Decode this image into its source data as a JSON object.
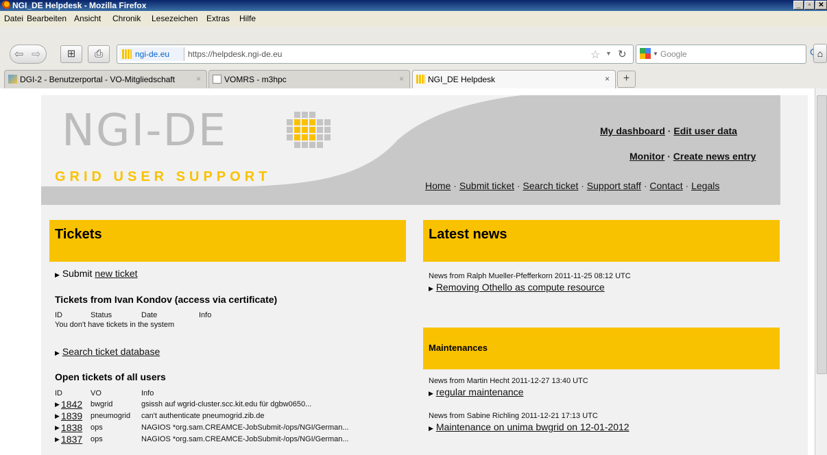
{
  "window": {
    "title": "NGI_DE Helpdesk - Mozilla Firefox"
  },
  "menu": [
    "Datei",
    "Bearbeiten",
    "Ansicht",
    "Chronik",
    "Lesezeichen",
    "Extras",
    "Hilfe"
  ],
  "urlbar": {
    "site": "ngi-de.eu",
    "url": "https://helpdesk.ngi-de.eu"
  },
  "search": {
    "placeholder": "Google"
  },
  "tabs": [
    {
      "label": "DGI-2 - Benutzerportal - VO-Mitgliedschaft"
    },
    {
      "label": "VOMRS - m3hpc"
    },
    {
      "label": "NGI_DE Helpdesk"
    }
  ],
  "logo": {
    "main": "NGI-DE",
    "sub": "GRID USER SUPPORT"
  },
  "header_links": {
    "dashboard": "My dashboard",
    "edit_user": "Edit user data",
    "monitor": "Monitor",
    "create_news": "Create news entry",
    "sep": "·"
  },
  "nav": [
    "Home",
    "Submit ticket",
    "Search ticket",
    "Support staff",
    "Contact",
    "Legals"
  ],
  "tickets": {
    "title": "Tickets",
    "submit_prefix": "Submit",
    "submit_link": "new ticket",
    "user_heading": "Tickets from Ivan Kondov (access via certificate)",
    "cols": {
      "id": "ID",
      "status": "Status",
      "date": "Date",
      "info": "Info",
      "vo": "VO"
    },
    "empty_msg": "You don't have tickets in the system",
    "search_link": "Search ticket database",
    "open_heading": "Open tickets of all users",
    "rows": [
      {
        "id": "1842",
        "vo": "bwgrid",
        "info": "gsissh auf wgrid-cluster.scc.kit.edu für dgbw0650..."
      },
      {
        "id": "1839",
        "vo": "pneumogrid",
        "info": "can't authenticate pneumogrid.zib.de"
      },
      {
        "id": "1838",
        "vo": "ops",
        "info": "NAGIOS *org.sam.CREAMCE-JobSubmit-/ops/NGI/German..."
      },
      {
        "id": "1837",
        "vo": "ops",
        "info": "NAGIOS *org.sam.CREAMCE-JobSubmit-/ops/NGI/German..."
      }
    ]
  },
  "news": {
    "title": "Latest news",
    "items": [
      {
        "meta": "News from Ralph Mueller-Pfefferkorn 2011-11-25 08:12 UTC",
        "link": "Removing Othello as compute resource"
      }
    ]
  },
  "maintenances": {
    "title": "Maintenances",
    "items": [
      {
        "meta": "News from Martin Hecht 2011-12-27 13:40 UTC",
        "link": "regular maintenance"
      },
      {
        "meta": "News from Sabine Richling 2011-12-21 17:13 UTC",
        "link": "Maintenance on unima bwgrid on 12-01-2012"
      }
    ]
  },
  "colors": {
    "accent": "#f9c200",
    "panel": "#f1f1f1",
    "header_gray": "#c8c8c8"
  }
}
